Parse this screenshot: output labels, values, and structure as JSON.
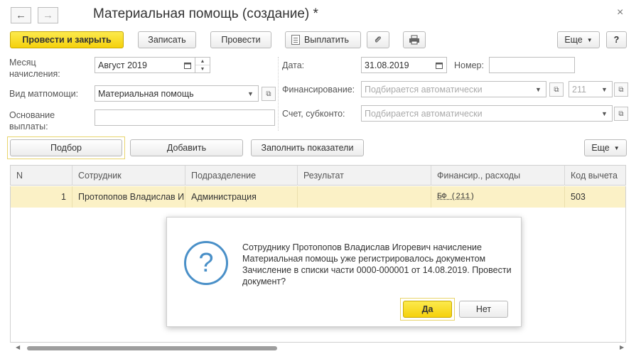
{
  "window": {
    "title": "Материальная помощь (создание) *",
    "back_glyph": "←",
    "forward_glyph": "→",
    "close_glyph": "×"
  },
  "toolbar": {
    "post_close": "Провести и закрыть",
    "save": "Записать",
    "post": "Провести",
    "pay": "Выплатить",
    "more": "Еще",
    "help": "?"
  },
  "form": {
    "month_label": "Месяц\nначисления:",
    "month_value": "Август 2019",
    "aid_type_label": "Вид матпомощи:",
    "aid_type_value": "Материальная помощь",
    "basis_label": "Основание\nвыплаты:",
    "basis_value": "",
    "date_label": "Дата:",
    "date_value": "31.08.2019",
    "number_label": "Номер:",
    "number_value": "",
    "financing_label": "Финансирование:",
    "financing_placeholder": "Подбирается автоматически",
    "financing_code": "211",
    "account_label": "Счет, субконто:",
    "account_placeholder": "Подбирается автоматически"
  },
  "table_toolbar": {
    "select": "Подбор",
    "add": "Добавить",
    "fill": "Заполнить показатели",
    "more": "Еще"
  },
  "table": {
    "columns": [
      "N",
      "Сотрудник",
      "Подразделение",
      "Результат",
      "Финансир., расходы",
      "Код вычета"
    ],
    "rows": [
      {
        "n": "1",
        "employee": "Протопопов Владислав Игоревич",
        "department": "Администрация",
        "result": "",
        "financing": "БФ (211)",
        "code": "503"
      }
    ]
  },
  "dialog": {
    "icon": "?",
    "message": "Сотруднику Протопопов Владислав Игоревич начисление Материальная помощь уже регистрировалось документом Зачисление в списки части 0000-000001 от 14.08.2019. Провести документ?",
    "yes": "Да",
    "no": "Нет"
  },
  "colors": {
    "primary": "#f5d10b",
    "selected_row": "#fbf1c6",
    "dialog_icon": "#4a90c8"
  }
}
